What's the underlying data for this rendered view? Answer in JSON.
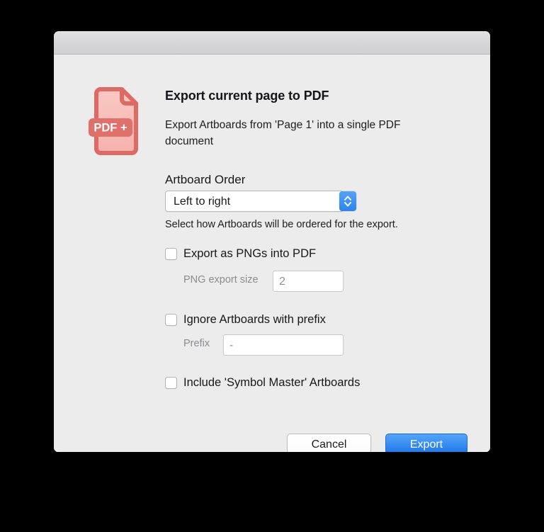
{
  "dialog": {
    "titlebar": {
      "title": ""
    },
    "icon": {
      "name": "pdf-plus-document-icon",
      "badge_text": "PDF +",
      "color_outline": "#de6a63",
      "color_fill": "#f7bdb8",
      "color_badge": "#de6a63"
    },
    "headline": "Export current page to PDF",
    "subtitle": "Export Artboards from 'Page 1' into a single PDF document",
    "artboard_order": {
      "label": "Artboard Order",
      "selected": "Left to right",
      "options": [
        "Left to right"
      ],
      "hint": "Select how Artboards will be ordered for the export."
    },
    "options": [
      {
        "id": "export-as-pngs",
        "label": "Export as PNGs into PDF",
        "checked": false,
        "sub_field": {
          "label": "PNG export size",
          "value": "2",
          "placeholder": "2"
        }
      },
      {
        "id": "ignore-artboards-prefix",
        "label": "Ignore Artboards with prefix",
        "checked": false,
        "sub_field": {
          "label": "Prefix",
          "value": "-",
          "placeholder": "-"
        }
      },
      {
        "id": "include-symbol-master",
        "label": "Include 'Symbol Master' Artboards",
        "checked": false
      }
    ],
    "buttons": {
      "cancel": "Cancel",
      "export": "Export"
    },
    "colors": {
      "accent_blue": "#2f8bf0",
      "window_bg": "#ececec",
      "titlebar_bg": "#d9d9dc"
    }
  }
}
